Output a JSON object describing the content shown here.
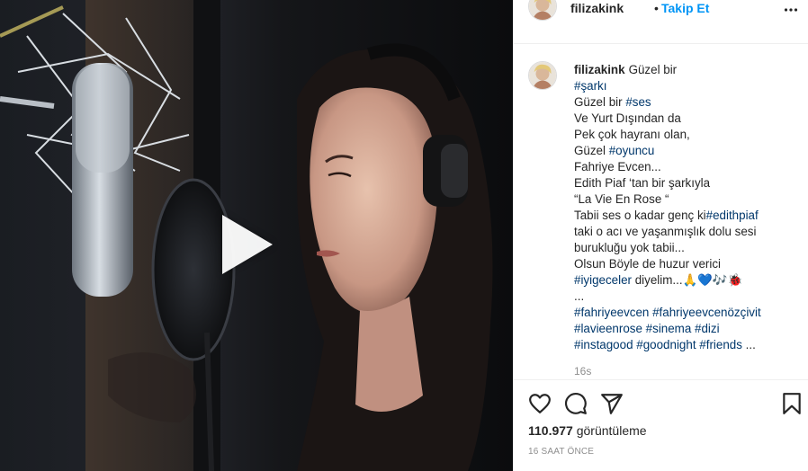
{
  "post": {
    "username": "filizakink",
    "separator": "•",
    "follow_label": "Takip Et",
    "more_icon": "more-horizontal-icon",
    "caption_lines": [
      [
        {
          "t": "Güzel bir",
          "tag": false
        }
      ],
      [
        {
          "t": "#şarkı",
          "tag": true
        }
      ],
      [
        {
          "t": "Güzel bir ",
          "tag": false
        },
        {
          "t": "#ses",
          "tag": true
        }
      ],
      [
        {
          "t": "Ve Yurt Dışından da",
          "tag": false
        }
      ],
      [
        {
          "t": "Pek çok hayranı olan,",
          "tag": false
        }
      ],
      [
        {
          "t": "Güzel ",
          "tag": false
        },
        {
          "t": "#oyuncu",
          "tag": true
        }
      ],
      [
        {
          "t": "Fahriye Evcen...",
          "tag": false
        }
      ],
      [
        {
          "t": "Edith Piaf ‘tan bir şarkıyla",
          "tag": false
        }
      ],
      [
        {
          "t": "“La Vie En Rose “",
          "tag": false
        }
      ],
      [
        {
          "t": "Tabii ses o kadar genç ki",
          "tag": false
        },
        {
          "t": "#edithpiaf",
          "tag": true
        }
      ],
      [
        {
          "t": "taki o acı ve yaşanmışlık dolu sesi",
          "tag": false
        }
      ],
      [
        {
          "t": "buruk­luğu yok tabii...",
          "tag": false
        }
      ],
      [
        {
          "t": "Olsun Böyle de huzur verici",
          "tag": false
        }
      ],
      [
        {
          "t": "#iyigeceler",
          "tag": true
        },
        {
          "t": " diyelim...🙏💙🎶🐞",
          "tag": false
        }
      ],
      [
        {
          "t": "...",
          "tag": false
        }
      ],
      [
        {
          "t": "#fahriyeevcen",
          "tag": true
        },
        {
          "t": " ",
          "tag": false
        },
        {
          "t": "#fahriyeevcenözçivit",
          "tag": true
        }
      ],
      [
        {
          "t": "#lavieenrose",
          "tag": true
        },
        {
          "t": " ",
          "tag": false
        },
        {
          "t": "#sinema",
          "tag": true
        },
        {
          "t": " ",
          "tag": false
        },
        {
          "t": "#dizi",
          "tag": true
        }
      ],
      [
        {
          "t": "#instagood",
          "tag": true
        },
        {
          "t": " ",
          "tag": false
        },
        {
          "t": "#goodnight",
          "tag": true
        },
        {
          "t": " ",
          "tag": false
        },
        {
          "t": "#friends",
          "tag": true
        },
        {
          "t": " ...",
          "tag": false
        }
      ]
    ],
    "caption_age": "16s",
    "views_count": "110.977",
    "views_label": "görüntüleme",
    "post_time": "16 SAAT ÖNCE"
  },
  "media": {
    "play_icon": "play-icon"
  },
  "actions": {
    "like_icon": "heart-icon",
    "comment_icon": "comment-icon",
    "share_icon": "share-icon",
    "save_icon": "bookmark-icon"
  },
  "colors": {
    "link_blue": "#0095f6",
    "hashtag": "#00376b",
    "muted": "#8e8e8e",
    "text": "#262626"
  }
}
